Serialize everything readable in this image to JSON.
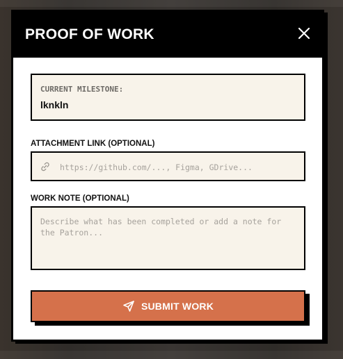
{
  "modal": {
    "title": "PROOF OF WORK",
    "close_icon": "close-icon"
  },
  "milestone": {
    "label": "CURRENT MILESTONE:",
    "value": "lknkln"
  },
  "attachment": {
    "label": "ATTACHMENT LINK (OPTIONAL)",
    "placeholder": "https://github.com/..., Figma, GDrive...",
    "value": "",
    "icon": "link-icon"
  },
  "note": {
    "label": "WORK NOTE (OPTIONAL)",
    "placeholder": "Describe what has been completed or add a note for the Patron...",
    "value": ""
  },
  "submit": {
    "label": "SUBMIT WORK",
    "icon": "send-icon"
  },
  "colors": {
    "accent": "#d5714b",
    "field_bg": "#f8f3ea",
    "header_bg": "#000000"
  }
}
